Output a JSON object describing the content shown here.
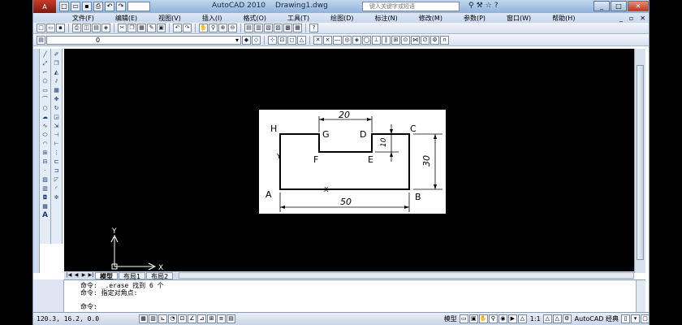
{
  "app": {
    "logo_label": "A",
    "title": "AutoCAD 2010",
    "document": "Drawing1.dwg",
    "search_placeholder": "键入关键字或短语",
    "workspace_box": "  "
  },
  "menu": {
    "items": [
      "文件(F)",
      "编辑(E)",
      "视图(V)",
      "插入(I)",
      "格式(O)",
      "工具(T)",
      "绘图(D)",
      "标注(N)",
      "修改(M)",
      "参数(P)",
      "窗口(W)",
      "帮助(H)"
    ]
  },
  "layer": {
    "current": "0"
  },
  "drawing": {
    "points": {
      "H": "H",
      "G": "G",
      "D": "D",
      "C": "C",
      "F": "F",
      "E": "E",
      "A": "A",
      "B": "B"
    },
    "dims": {
      "top_width": "20",
      "notch_depth": "10",
      "height": "30",
      "width": "50"
    },
    "ucs_small_y": "Y",
    "ucs_small_x": "X"
  },
  "ucs": {
    "y": "Y",
    "x": "X"
  },
  "tabs": {
    "model": "模型",
    "layout1": "布局1",
    "layout2": "布局2"
  },
  "command": {
    "line1": "命令:  _.erase 找到 6 个",
    "line2": "命令: 指定对角点:",
    "prompt": "命令:"
  },
  "status": {
    "coords": "120.3, 16.2, 0.0",
    "model_label": "模型",
    "scale": "1:1",
    "workspace": "AutoCAD 经典"
  },
  "colors": {
    "canvas": "#000000",
    "title_bar": "#8fb2d8",
    "app_button": "#c83a28"
  }
}
